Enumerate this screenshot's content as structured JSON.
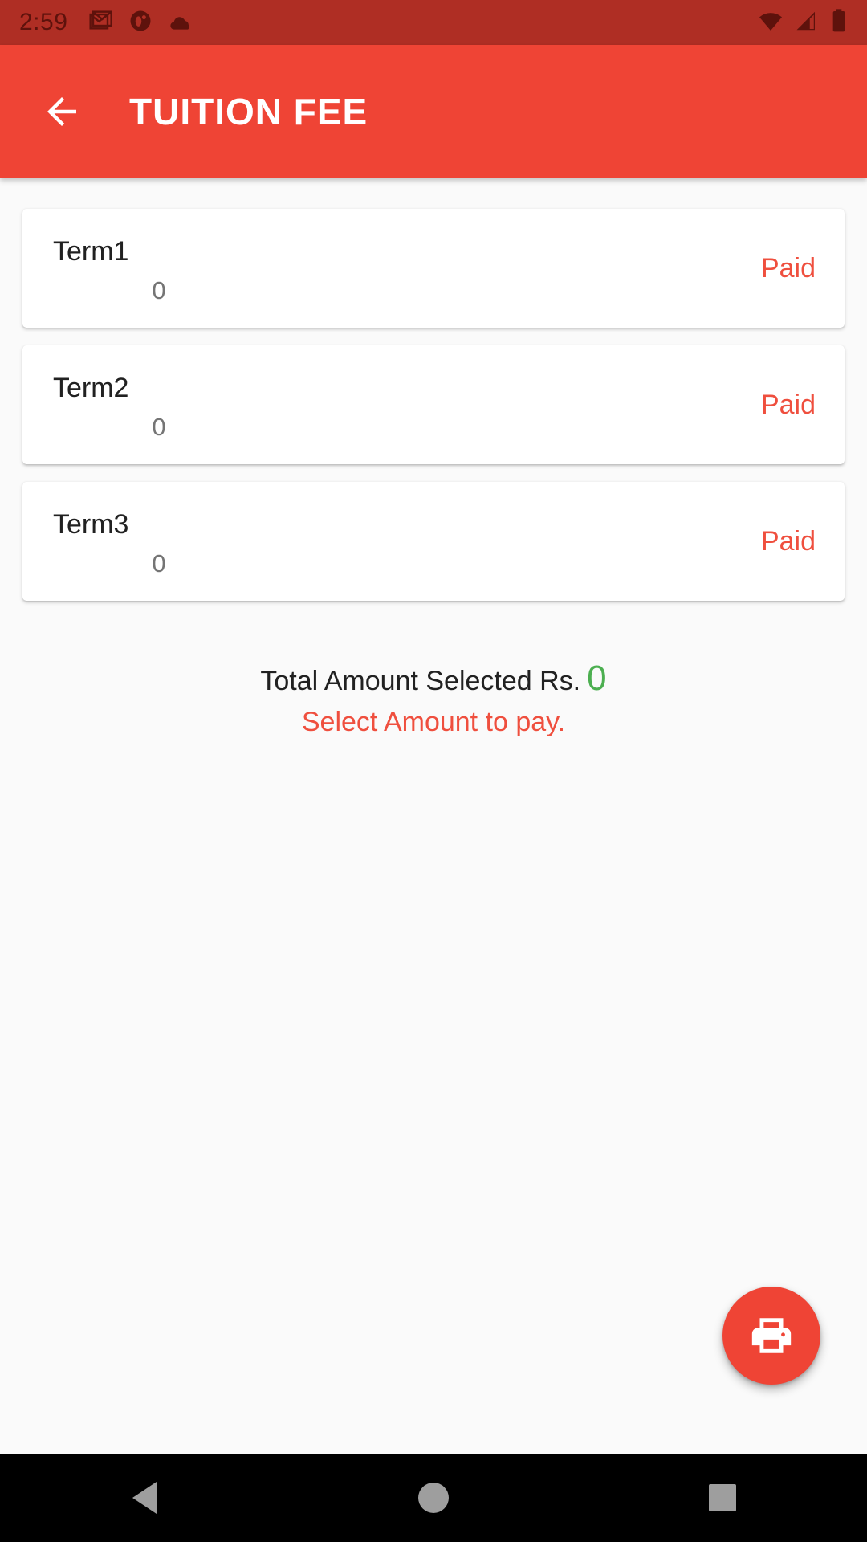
{
  "status_bar": {
    "time": "2:59",
    "background_color": "#AF2E24",
    "left_icons": [
      "gmail-icon",
      "app-circle-icon",
      "cloud-icon"
    ],
    "right_icons": [
      "wifi-icon",
      "cellular-signal-icon",
      "battery-icon"
    ]
  },
  "app_bar": {
    "title": "TUITION FEE",
    "back_icon": "arrow-back-icon",
    "background_color": "#EF4435",
    "text_color": "#FFFFFF"
  },
  "fee_terms": [
    {
      "name": "Term1",
      "amount": "0",
      "status": "Paid"
    },
    {
      "name": "Term2",
      "amount": "0",
      "status": "Paid"
    },
    {
      "name": "Term3",
      "amount": "0",
      "status": "Paid"
    }
  ],
  "total": {
    "label": "Total Amount Selected Rs.",
    "value": "0",
    "value_color": "#4CAF50",
    "hint": "Select Amount to pay.",
    "hint_color": "#EF4F3E"
  },
  "fab": {
    "icon": "print-icon",
    "background_color": "#EF4435"
  },
  "nav_bar": {
    "background_color": "#000000",
    "buttons": [
      "back-triangle-icon",
      "home-circle-icon",
      "recents-square-icon"
    ]
  },
  "colors": {
    "status_bar": "#AF2E24",
    "primary": "#EF4435",
    "accent_paid": "#EF4F3E",
    "amount_green": "#4CAF50",
    "page_background": "#FAFAFA",
    "card_background": "#FFFFFF"
  }
}
